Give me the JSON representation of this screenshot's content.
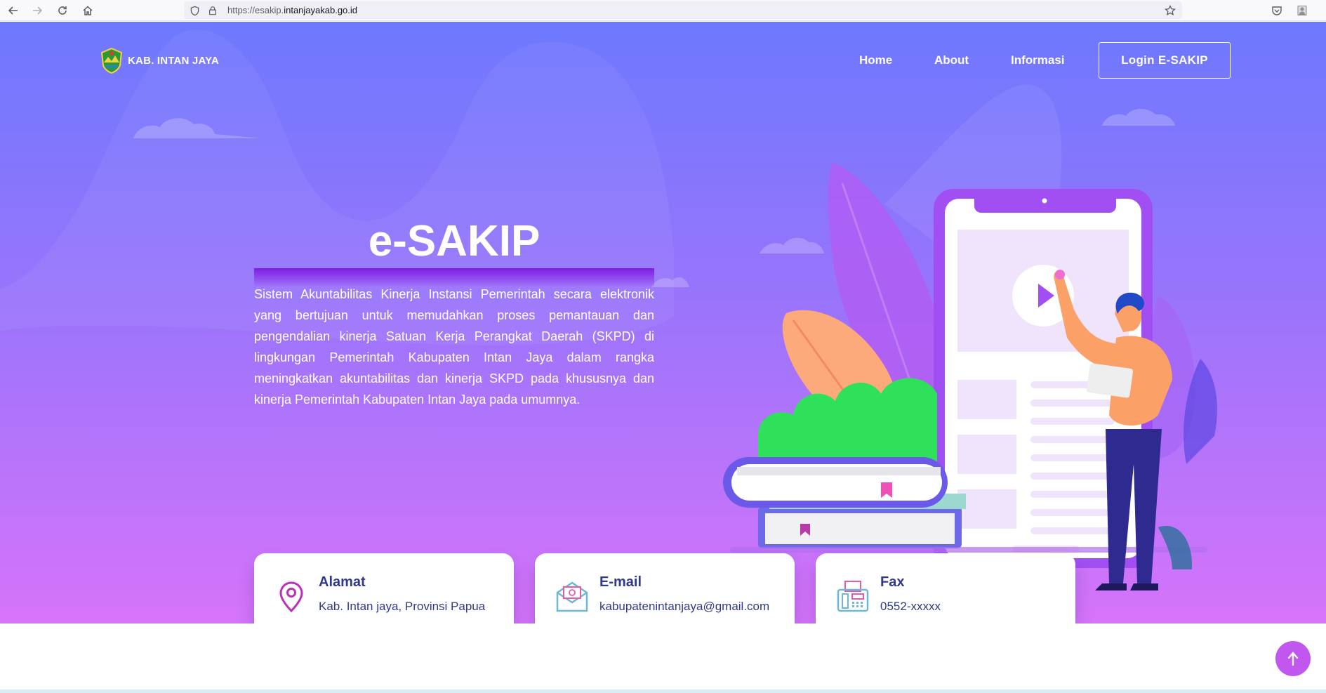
{
  "browser": {
    "url_prefix": "https://esakip.",
    "url_domain": "intanjayakab.go.id"
  },
  "brand": {
    "name": "KAB. INTAN JAYA"
  },
  "nav": {
    "home": "Home",
    "about": "About",
    "informasi": "Informasi",
    "login": "Login E-SAKIP"
  },
  "hero": {
    "title": "e-SAKIP",
    "description": "Sistem Akuntabilitas Kinerja Instansi Pemerintah secara elektronik yang bertujuan untuk memudahkan proses pemantauan dan pengendalian kinerja Satuan Kerja Perangkat Daerah (SKPD) di lingkungan Pemerintah Kabupaten Intan Jaya dalam rangka meningkatkan akuntabilitas dan kinerja SKPD pada khususnya dan kinerja Pemerintah Kabupaten Intan Jaya pada umumnya."
  },
  "cards": [
    {
      "title": "Alamat",
      "text": "Kab. Intan jaya, Provinsi Papua",
      "icon": "location-pin-icon"
    },
    {
      "title": "E-mail",
      "text": "kabupatenintanjaya@gmail.com",
      "icon": "envelope-icon"
    },
    {
      "title": "Fax",
      "text": "0552-xxxxx",
      "icon": "fax-machine-icon"
    }
  ],
  "colors": {
    "hero_top": "#6d79fe",
    "hero_bottom": "#d674fa",
    "card_text": "#2f3a8a",
    "accent": "#c157ee"
  }
}
